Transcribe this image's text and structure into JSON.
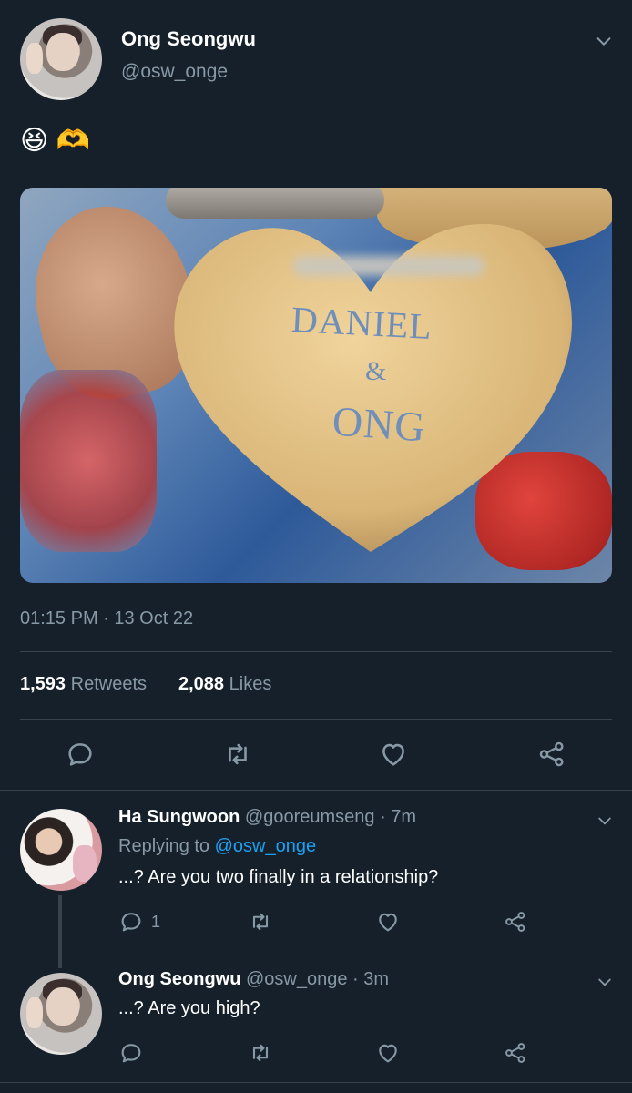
{
  "tweet": {
    "author_name": "Ong Seongwu",
    "author_handle": "@osw_onge",
    "emoji_text": "😆 🫶",
    "image_text": [
      "DANIEL",
      "&",
      "ONG"
    ],
    "timestamp": "01:15 PM · 13 Oct 22",
    "retweets_count": "1,593",
    "retweets_label": "Retweets",
    "likes_count": "2,088",
    "likes_label": "Likes"
  },
  "replies": [
    {
      "name": "Ha Sungwoon",
      "handle": "@gooreumseng",
      "time": "· 7m",
      "replying_prefix": "Replying to",
      "replying_to": "@osw_onge",
      "text": "...? Are you two finally in a relationship?",
      "reply_count": "1"
    },
    {
      "name": "Ong Seongwu",
      "handle": "@osw_onge",
      "time": "· 3m",
      "text": "...? Are you high?"
    }
  ],
  "colors": {
    "background": "#15202b",
    "muted": "#8899a6",
    "link": "#1da1f2",
    "divider": "#38444d"
  }
}
